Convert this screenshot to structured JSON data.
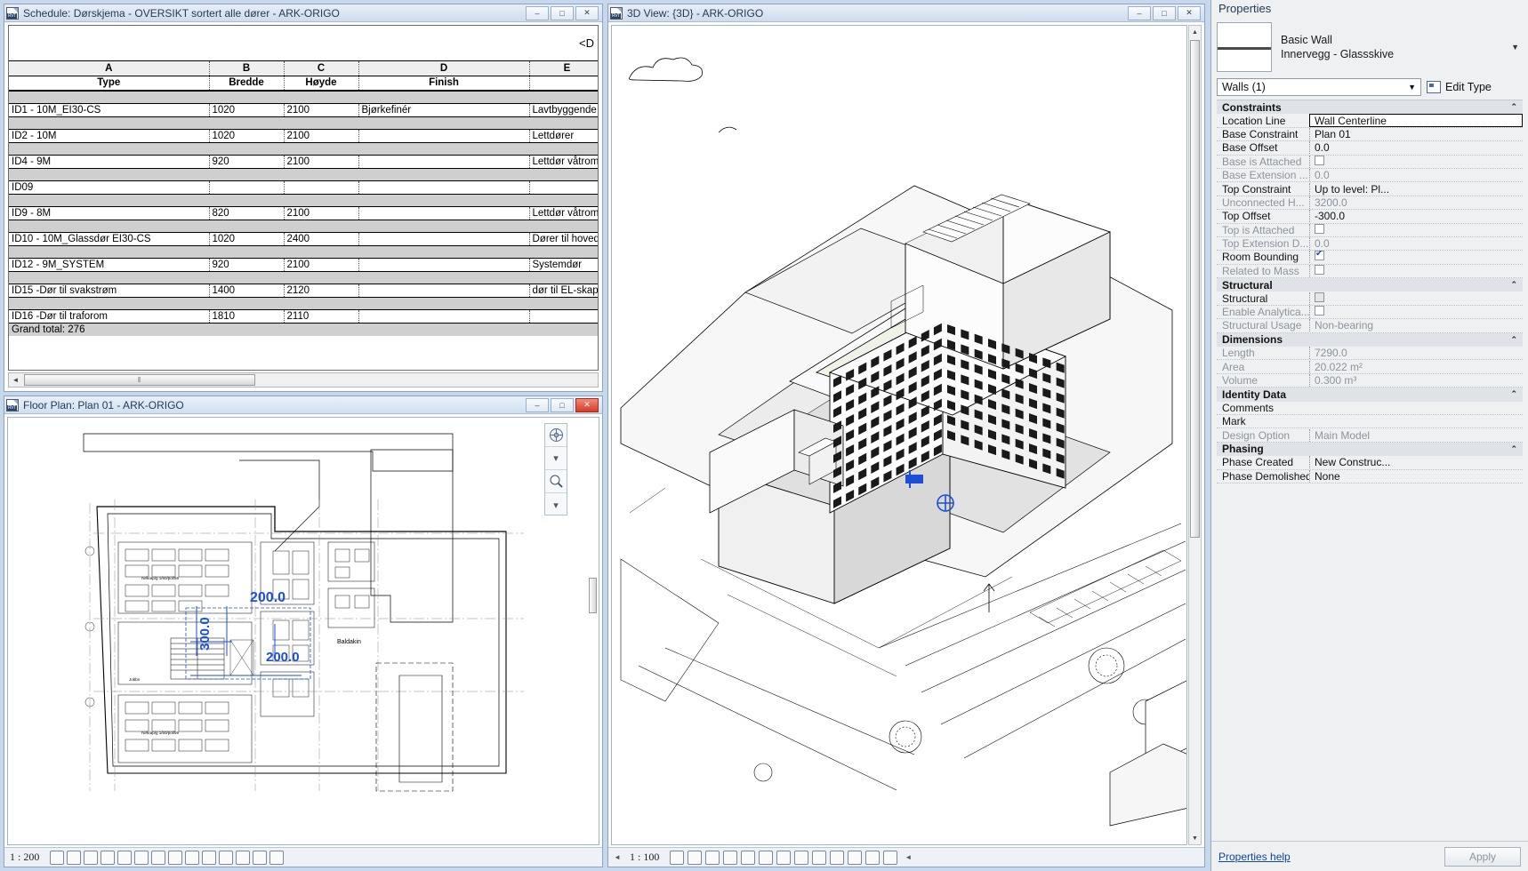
{
  "schedule_window": {
    "title": "Schedule: Dørskjema - OVERSIKT sortert alle dører - ARK-ORIGO",
    "icon": "revit-file-icon",
    "header_right_text": "<D",
    "buttons": {
      "minimize": "–",
      "maximize": "□",
      "close": "✕"
    },
    "column_letters": [
      "A",
      "B",
      "C",
      "D",
      "E"
    ],
    "column_headers": [
      "Type",
      "Bredde",
      "Høyde",
      "Finish",
      ""
    ],
    "rows": [
      {
        "type": "ID1 - 10M_EI30-CS",
        "bredde": "1020",
        "hoyde": "2100",
        "finish": "Bjørkefinér",
        "e": "Lavtbyggende te"
      },
      {
        "type": "ID2 - 10M",
        "bredde": "1020",
        "hoyde": "2100",
        "finish": "",
        "e": "Lettdører"
      },
      {
        "type": "ID4 - 9M",
        "bredde": "920",
        "hoyde": "2100",
        "finish": "",
        "e": "Lettdør våtrom"
      },
      {
        "type": "ID09",
        "bredde": "",
        "hoyde": "",
        "finish": "",
        "e": ""
      },
      {
        "type": "ID9 - 8M",
        "bredde": "820",
        "hoyde": "2100",
        "finish": "",
        "e": "Lettdør våtrom"
      },
      {
        "type": "ID10 - 10M_Glassdør EI30-CS",
        "bredde": "1020",
        "hoyde": "2400",
        "finish": "",
        "e": "Dører til hovedtra"
      },
      {
        "type": "ID12 - 9M_SYSTEM",
        "bredde": "920",
        "hoyde": "2100",
        "finish": "",
        "e": "Systemdør"
      },
      {
        "type": "ID15 -Dør til svakstrøm",
        "bredde": "1400",
        "hoyde": "2120",
        "finish": "",
        "e": "dør til EL-skap"
      },
      {
        "type": "ID16 -Dør til traforom",
        "bredde": "1810",
        "hoyde": "2110",
        "finish": "",
        "e": ""
      }
    ],
    "grand_total": "Grand total: 276",
    "scroll_thumb_grip": "⦀"
  },
  "view3d_window": {
    "title": "3D View: {3D} - ARK-ORIGO",
    "icon": "revit-file-icon",
    "buttons": {
      "minimize": "–",
      "maximize": "□",
      "close": "✕"
    },
    "scale": "1 : 100",
    "status_icons": [
      "model-graphics-style-icon",
      "visual-style-shaded-icon",
      "sun-path-off-icon",
      "shadows-off-icon",
      "rendering-dialog-icon",
      "crop-view-icon",
      "show-crop-region-icon",
      "lock-3d-view-icon",
      "temporary-hide-isolate-icon",
      "reveal-hidden-elements-icon",
      "temporary-view-properties-icon",
      "analytical-model-icon",
      "constraints-icon"
    ],
    "overflow_arrow": "◄"
  },
  "floorplan_window": {
    "title": "Floor Plan: Plan 01 - ARK-ORIGO",
    "icon": "revit-file-icon",
    "buttons": {
      "minimize": "–",
      "maximize": "□",
      "close": "✕"
    },
    "scale": "1 : 200",
    "status_icons": [
      "model-graphics-style-icon",
      "visual-style-wireframe-icon",
      "sun-path-off-icon",
      "shadows-off-icon",
      "rendering-dialog-icon",
      "crop-view-icon",
      "show-crop-region-icon",
      "lock-view-icon",
      "temporary-hide-isolate-icon",
      "reveal-hidden-elements-icon",
      "temporary-view-properties-icon",
      "worksharing-display-icon",
      "design-options-icon",
      "main-model-icon"
    ],
    "nav_buttons": [
      "steering-wheel-icon",
      "chevron-down-icon",
      "zoom-region-icon",
      "chevron-down-icon"
    ],
    "annotations": [
      "200.0",
      "300.0",
      "200.0",
      "Baldakin"
    ]
  },
  "properties": {
    "panel_title": "Properties",
    "type_family": "Basic Wall",
    "type_name": "Innervegg - Glassskive",
    "dropdown_caret": "▼",
    "selector_value": "Walls (1)",
    "edit_type_label": "Edit Type",
    "groups": [
      {
        "name": "Constraints",
        "collapse_glyph": "⌃",
        "params": [
          {
            "name": "Location Line",
            "value": "Wall Centerline",
            "dim": false,
            "selected": true,
            "kind": "text"
          },
          {
            "name": "Base Constraint",
            "value": "Plan 01",
            "dim": false,
            "kind": "text"
          },
          {
            "name": "Base Offset",
            "value": "0.0",
            "dim": false,
            "kind": "text"
          },
          {
            "name": "Base is Attached",
            "value": "",
            "dim": true,
            "kind": "checkbox",
            "checked": false
          },
          {
            "name": "Base Extension ...",
            "value": "0.0",
            "dim": true,
            "kind": "text"
          },
          {
            "name": "Top Constraint",
            "value": "Up to level: Pl...",
            "dim": false,
            "kind": "text"
          },
          {
            "name": "Unconnected H...",
            "value": "3200.0",
            "dim": true,
            "kind": "text"
          },
          {
            "name": "Top Offset",
            "value": "-300.0",
            "dim": false,
            "kind": "text"
          },
          {
            "name": "Top is Attached",
            "value": "",
            "dim": true,
            "kind": "checkbox",
            "checked": false
          },
          {
            "name": "Top Extension D...",
            "value": "0.0",
            "dim": true,
            "kind": "text"
          },
          {
            "name": "Room Bounding",
            "value": "",
            "dim": false,
            "kind": "checkbox",
            "checked": true
          },
          {
            "name": "Related to Mass",
            "value": "",
            "dim": true,
            "kind": "checkbox",
            "checked": false
          }
        ]
      },
      {
        "name": "Structural",
        "collapse_glyph": "⌃",
        "params": [
          {
            "name": "Structural",
            "value": "",
            "dim": false,
            "kind": "checkbox-gray",
            "checked": false
          },
          {
            "name": "Enable Analytica...",
            "value": "",
            "dim": true,
            "kind": "checkbox",
            "checked": false
          },
          {
            "name": "Structural Usage",
            "value": "Non-bearing",
            "dim": true,
            "kind": "text"
          }
        ]
      },
      {
        "name": "Dimensions",
        "collapse_glyph": "⌃",
        "params": [
          {
            "name": "Length",
            "value": "7290.0",
            "dim": true,
            "kind": "text"
          },
          {
            "name": "Area",
            "value": "20.022 m²",
            "dim": true,
            "kind": "text"
          },
          {
            "name": "Volume",
            "value": "0.300 m³",
            "dim": true,
            "kind": "text"
          }
        ]
      },
      {
        "name": "Identity Data",
        "collapse_glyph": "⌃",
        "params": [
          {
            "name": "Comments",
            "value": "",
            "dim": false,
            "kind": "text"
          },
          {
            "name": "Mark",
            "value": "",
            "dim": false,
            "kind": "text"
          },
          {
            "name": "Design Option",
            "value": "Main Model",
            "dim": true,
            "kind": "text"
          }
        ]
      },
      {
        "name": "Phasing",
        "collapse_glyph": "⌃",
        "params": [
          {
            "name": "Phase Created",
            "value": "New Construc...",
            "dim": false,
            "kind": "text"
          },
          {
            "name": "Phase Demolished",
            "value": "None",
            "dim": false,
            "kind": "text"
          }
        ]
      }
    ],
    "help_link": "Properties help",
    "apply_button": "Apply"
  }
}
